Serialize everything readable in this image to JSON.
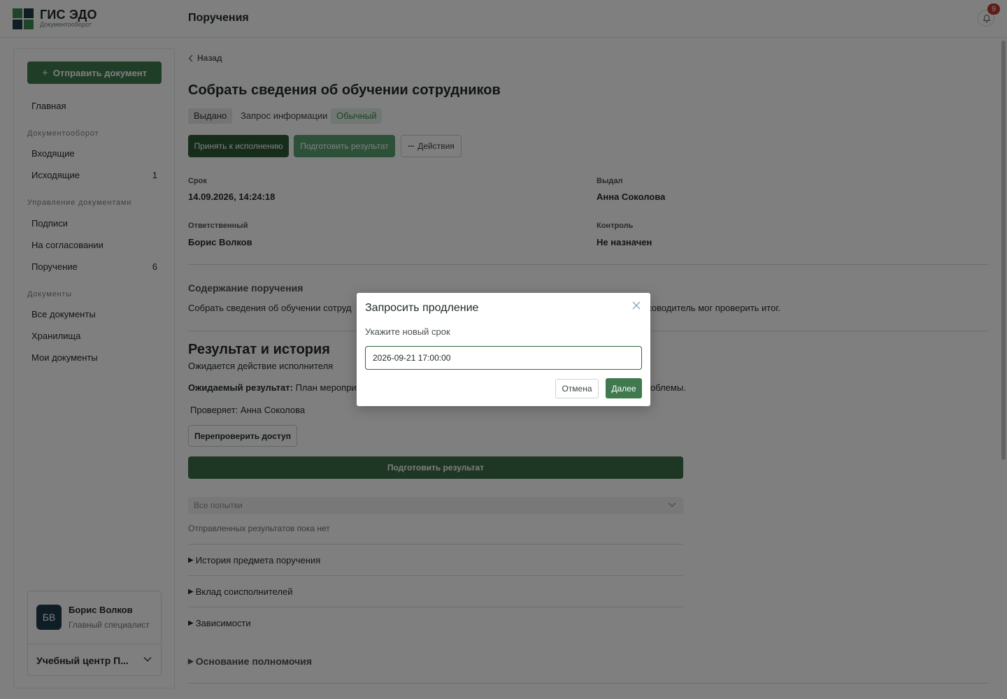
{
  "app": {
    "brand": "ГИС ЭДО",
    "brand_sub": "Документооборот",
    "page_heading": "Поручения",
    "notifications": "9"
  },
  "colors": {
    "accent": "#3f7a4f",
    "accent_dark": "#2d5a38",
    "badge": "#c0392b",
    "logo_green": "#3c8a4f",
    "logo_navy": "#1e3a4a"
  },
  "sidebar": {
    "send_button": "Отправить документ",
    "items": [
      {
        "label": "Главная",
        "count": ""
      },
      {
        "label": "Входящие",
        "count": ""
      },
      {
        "label": "Исходящие",
        "count": "1"
      },
      {
        "label": "Подписи",
        "count": ""
      },
      {
        "label": "На согласовании",
        "count": ""
      },
      {
        "label": "Поручение",
        "count": "6"
      },
      {
        "label": "Все документы",
        "count": ""
      },
      {
        "label": "Хранилища",
        "count": ""
      },
      {
        "label": "Мои документы",
        "count": ""
      }
    ],
    "sections": [
      "Документооборот",
      "Управление документами",
      "Документы"
    ],
    "user": {
      "initials": "БВ",
      "name": "Борис Волков",
      "role": "Главный специалист",
      "org": "Учебный центр П..."
    }
  },
  "main": {
    "back": "Назад",
    "title": "Собрать сведения об обучении сотрудников",
    "tags": [
      "Выдано",
      "Запрос информации",
      "Обычный"
    ],
    "buttons": {
      "accept": "Принять к исполнению",
      "prepare": "Подготовить результат",
      "actions": "Действия"
    },
    "meta": {
      "deadline_label": "Срок",
      "deadline": "14.09.2026, 14:24:18",
      "issuer_label": "Выдал",
      "issuer": "Анна Соколова",
      "responsible_label": "Ответственный",
      "responsible": "Борис Волков",
      "control_label": "Контроль",
      "control": "Не назначен"
    },
    "content_title": "Содержание поручения",
    "content_text_left": "Собрать сведения об обучении сотруд",
    "content_text_right": "ководитель мог проверить итог.",
    "result_title": "Результат и история",
    "result_status": "Ожидается действие исполнителя",
    "expected_label": "Ожидаемый результат:",
    "expected_left": "План мероприя",
    "expected_right": "облемы.",
    "checker": "Проверяет: Анна Соколова",
    "recheck": "Перепроверить доступ",
    "prepare_big": "Подготовить результат",
    "attempts": "Все попытки",
    "no_results": "Отправленных результатов пока нет",
    "accordions": [
      "История предмета поручения",
      "Вклад соисполнителей",
      "Зависимости",
      "Основание полномочия"
    ]
  },
  "modal": {
    "title": "Запросить продление",
    "label": "Укажите новый срок",
    "value": "2026-09-21 17:00:00",
    "cancel": "Отмена",
    "next": "Далее"
  }
}
